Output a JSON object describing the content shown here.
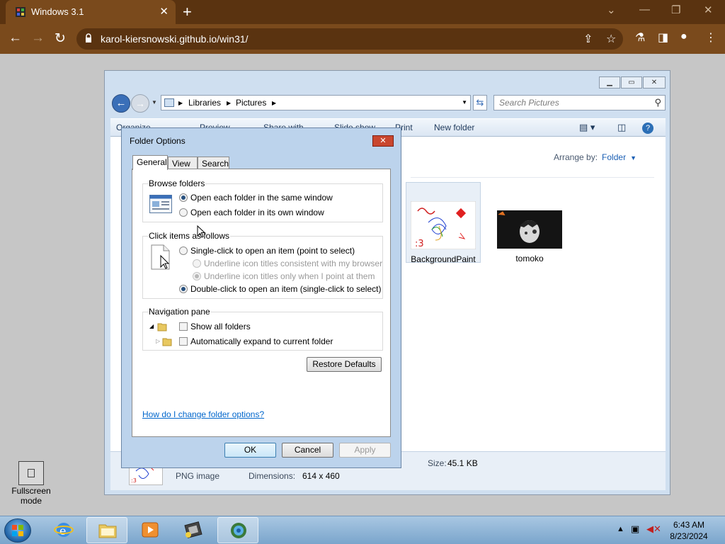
{
  "browser": {
    "tab_title": "Windows 3.1",
    "url": "karol-kiersnowski.github.io/win31/",
    "tab_close": "✕",
    "new_tab": "+"
  },
  "explorer": {
    "breadcrumb": [
      "Libraries",
      "Pictures"
    ],
    "search_placeholder": "Search Pictures",
    "commands": [
      "Organize",
      "Preview",
      "Share with",
      "Slide show",
      "Print",
      "New folder"
    ],
    "arrange_label": "Arrange by:",
    "arrange_value": "Folder",
    "files": [
      {
        "name": "BackgroundPaint",
        "selected": true
      },
      {
        "name": "tomoko",
        "selected": false
      }
    ],
    "details": {
      "type": "PNG image",
      "dimensions_label": "Dimensions:",
      "dimensions_value": "614 x 460",
      "size_label": "Size:",
      "size_value": "45.1 KB"
    }
  },
  "dialog": {
    "title": "Folder Options",
    "tabs": [
      "General",
      "View",
      "Search"
    ],
    "active_tab": "General",
    "browse_group": {
      "label": "Browse folders",
      "options": [
        "Open each folder in the same window",
        "Open each folder in its own window"
      ],
      "selected": 0
    },
    "click_group": {
      "label": "Click items as follows",
      "single": "Single-click to open an item (point to select)",
      "underline_always": "Underline icon titles consistent with my browser",
      "underline_point": "Underline icon titles only when I point at them",
      "double": "Double-click to open an item (single-click to select)",
      "selected": "double"
    },
    "nav_group": {
      "label": "Navigation pane",
      "show_all": "Show all folders",
      "auto_expand": "Automatically expand to current folder"
    },
    "restore_defaults": "Restore Defaults",
    "help_link": "How do I change folder options?",
    "ok": "OK",
    "cancel": "Cancel",
    "apply": "Apply"
  },
  "desktop": {
    "fullscreen_label_1": "Fullscreen",
    "fullscreen_label_2": "mode"
  },
  "taskbar": {
    "time": "6:43 AM",
    "date": "8/23/2024"
  },
  "colors": {
    "browser_dark": "#5a3310",
    "browser_toolbar": "#7a4a1c",
    "explorer_frame": "#cfdff0",
    "link_blue": "#0066cc"
  }
}
